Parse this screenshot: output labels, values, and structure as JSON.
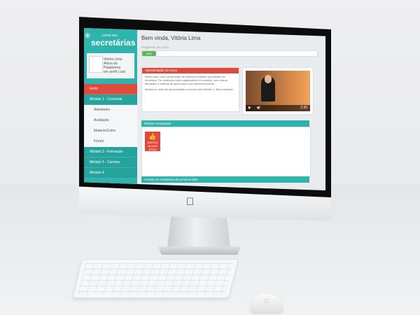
{
  "brand": {
    "logo_text": "secretárias",
    "logo_small": "portal das"
  },
  "profile": {
    "name_lines": [
      "Vitória Lima",
      "Aluna da Plataforma",
      "ver perfil | sair"
    ]
  },
  "menu": [
    {
      "label": "Início",
      "state": "active"
    },
    {
      "label": "Módulo 1 - Conteúdo",
      "state": "hl"
    },
    {
      "label": "Atividades",
      "state": "sub"
    },
    {
      "label": "Avaliação",
      "state": "sub"
    },
    {
      "label": "Material Extra",
      "state": "sub"
    },
    {
      "label": "Fórum",
      "state": "sub"
    },
    {
      "label": "Módulo 2 - Formação",
      "state": "hl"
    },
    {
      "label": "Módulo 3 - Carreira",
      "state": "hl"
    },
    {
      "label": "Módulo 4",
      "state": "hl"
    }
  ],
  "main": {
    "title": "Bem vinda, Vitória Lima",
    "progress_label": "Progresso do curso",
    "progress_value": "16%",
    "progress_fraction": 0.16,
    "welcome": {
      "header": "Apresentação do curso",
      "paragraph1": "Neste curso você vai aprender as melhores práticas da profissão de secretária. Os conteúdos estão organizados em módulos, com vídeos, atividades e material de apoio para o seu desenvolvimento.",
      "paragraph2": "Assista ao vídeo de apresentação e comece pelo Módulo 1. Bons estudos!"
    },
    "video": {
      "time": "2:30"
    },
    "badges_header": "Minhas Conquistas",
    "badge_label": "ALUNA ATIVA",
    "badge_small": "INICIOU",
    "next_header": "Acesse os conteúdos da próxima lição"
  },
  "colors": {
    "teal": "#2fb3ad",
    "red": "#e04a3c",
    "green": "#5cb85c"
  }
}
